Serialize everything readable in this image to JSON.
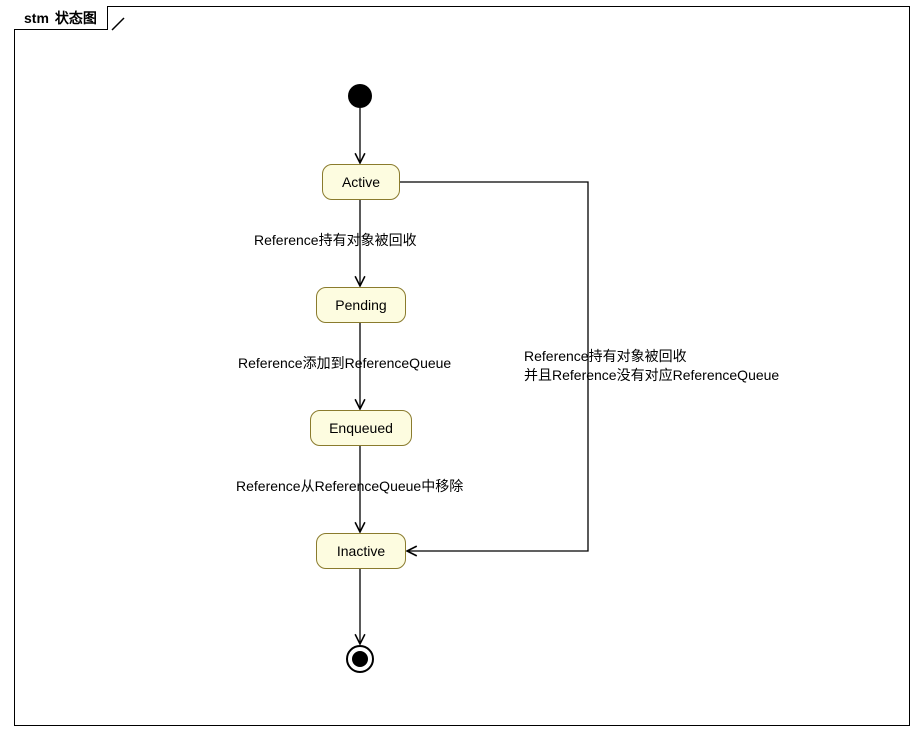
{
  "frame": {
    "prefix": "stm",
    "title": "状态图"
  },
  "states": {
    "active": "Active",
    "pending": "Pending",
    "enqueued": "Enqueued",
    "inactive": "Inactive"
  },
  "transitions": {
    "active_to_pending": "Reference持有对象被回收",
    "pending_to_enqueued": "Reference添加到ReferenceQueue",
    "enqueued_to_inactive": "Reference从ReferenceQueue中移除",
    "active_to_inactive_line1": "Reference持有对象被回收",
    "active_to_inactive_line2": "并且Reference没有对应ReferenceQueue"
  },
  "chart_data": {
    "type": "state_machine",
    "title": "stm 状态图",
    "initial": true,
    "final": true,
    "states": [
      "Active",
      "Pending",
      "Enqueued",
      "Inactive"
    ],
    "transitions": [
      {
        "from": "INITIAL",
        "to": "Active",
        "label": ""
      },
      {
        "from": "Active",
        "to": "Pending",
        "label": "Reference持有对象被回收"
      },
      {
        "from": "Pending",
        "to": "Enqueued",
        "label": "Reference添加到ReferenceQueue"
      },
      {
        "from": "Enqueued",
        "to": "Inactive",
        "label": "Reference从ReferenceQueue中移除"
      },
      {
        "from": "Active",
        "to": "Inactive",
        "label": "Reference持有对象被回收 并且Reference没有对应ReferenceQueue"
      },
      {
        "from": "Inactive",
        "to": "FINAL",
        "label": ""
      }
    ]
  }
}
